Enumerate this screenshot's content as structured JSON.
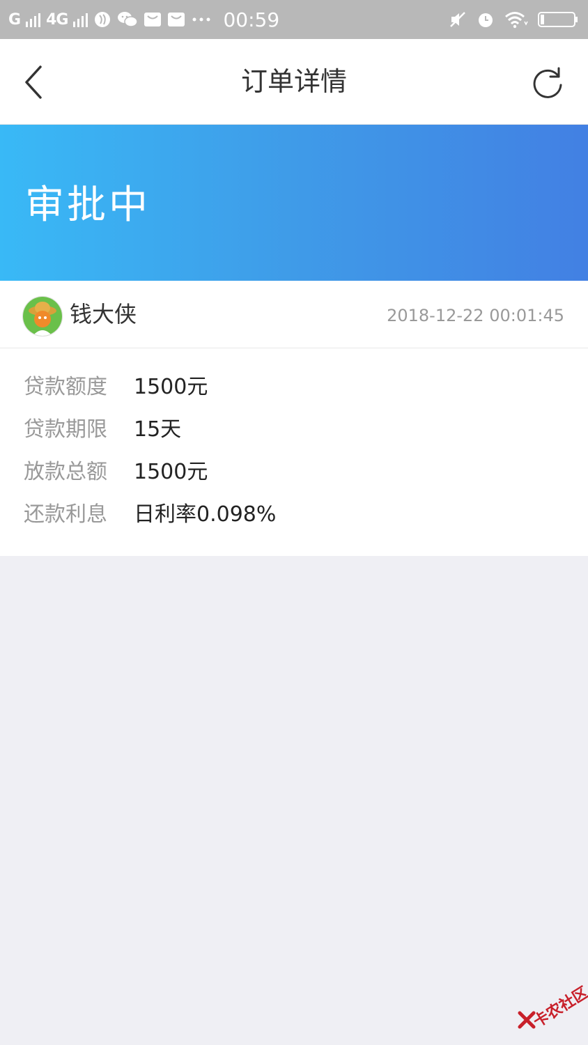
{
  "status_bar": {
    "network1": "G",
    "network2": "4G",
    "time": "00:59",
    "icons": [
      "signal-bars-icon",
      "globe-app-icon",
      "wechat-icon",
      "mail-icon",
      "mail-icon",
      "more-dots-icon",
      "mute-icon",
      "alarm-icon",
      "wifi-icon",
      "battery-icon"
    ]
  },
  "nav": {
    "title": "订单详情",
    "back_icon": "chevron-left-icon",
    "refresh_icon": "refresh-icon"
  },
  "banner": {
    "status": "审批中",
    "gradient_start": "#39b9f6",
    "gradient_end": "#4280e3"
  },
  "merchant": {
    "name": "钱大侠",
    "datetime": "2018-12-22 00:01:45"
  },
  "details": [
    {
      "label": "贷款额度",
      "value": "1500元"
    },
    {
      "label": "贷款期限",
      "value": "15天"
    },
    {
      "label": "放款总额",
      "value": "1500元"
    },
    {
      "label": "还款利息",
      "value": "日利率0.098%"
    }
  ],
  "watermark": {
    "text": "卡农社区"
  }
}
